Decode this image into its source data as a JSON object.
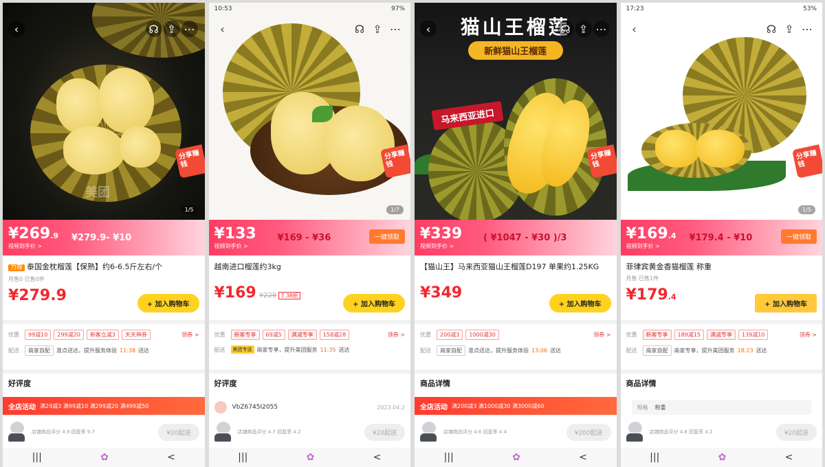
{
  "screens": [
    {
      "status": {
        "time": "",
        "right": ""
      },
      "watermark": "美团",
      "share": "分享赚钱",
      "pager": "1/5",
      "price_main": "¥269",
      "price_cents": ".9",
      "price_label": "视频到手价 >",
      "range": "¥279.9- ¥10",
      "range_label": "",
      "title_tag": "力荐",
      "title": "泰国金枕榴莲【保熟】约6-6.5斤左右/个",
      "subtitle": "月售0 已售0件",
      "big_price": "¥279.9",
      "old_price": "",
      "discount": "",
      "cart": "+ 加入购物车",
      "chips_label": "优惠",
      "chips": [
        "99减10",
        "299减20",
        "新客立减3",
        "天天神券"
      ],
      "more": "领券 >",
      "delivery_label": "配送",
      "delivery_tag": "商家自配",
      "delivery_text": "准点送达，提升服务体验",
      "delivery_time": "11:38",
      "delivery_end": "送达",
      "review": "好评度",
      "activity_title": "全店活动",
      "activity_text": "满29减3 满99减10 满299减20 满499减50",
      "bottom_text": "店铺商品评分 4.9   回复率 9.7",
      "follow": "¥20起送"
    },
    {
      "status": {
        "time": "10:53",
        "right": "97%"
      },
      "share": "分享赚钱",
      "pager": "1/7",
      "price_main": "¥133",
      "price_label": "视频到手价 >",
      "range": "¥169 - ¥36",
      "range_label": "",
      "grab": "一键领取",
      "title": "越南进口榴莲约3kg",
      "big_price": "¥169",
      "old_price": "¥229",
      "discount": "7.38折",
      "cart": "+ 加入购物车",
      "chips_label": "优惠",
      "chips": [
        "新客专享",
        "69减5",
        "满减专享",
        "158减28"
      ],
      "more": "领券 >",
      "delivery_label": "配送",
      "delivery_tag": "美团专送",
      "delivery_text": "商家专享，提升美团服务",
      "delivery_time": "11:35",
      "delivery_end": "送达",
      "review": "好评度",
      "user": "VbZ6745I2055",
      "user_date": "2023.04.2",
      "bottom_text": "店铺商品评分 4.7   回复率 4.2",
      "follow": "¥20起送"
    },
    {
      "status": {
        "time": "",
        "right": ""
      },
      "hero_title": "猫山王榴莲",
      "hero_sub": "新鲜猫山王榴莲",
      "import_tag": "马来西亚进口",
      "share": "分享赚钱",
      "price_main": "¥339",
      "price_label": "视频到手价 >",
      "range": "( ¥1047 - ¥30 )/3",
      "range_label": "",
      "title": "【猫山王】马来西亚猫山王榴莲D197 单果约1.25KG",
      "big_price": "¥349",
      "cart": "+ 加入购物车",
      "chips_label": "优惠",
      "chips": [
        "200减3",
        "1000减30"
      ],
      "more": "领券 >",
      "delivery_label": "配送",
      "delivery_tag": "商家自配",
      "delivery_text": "准点送达，提升服务体验",
      "delivery_time": "13:06",
      "delivery_end": "送达",
      "review": "商品详情",
      "activity_title": "全店活动",
      "activity_text": "满200减3 满1000减30 满3000减60",
      "bottom_text": "店铺商品评分 4.6   回复率 4.4",
      "follow": "¥200起送"
    },
    {
      "status": {
        "time": "17:23",
        "right": "53%"
      },
      "share": "分享赚钱",
      "pager": "1/5",
      "price_main": "¥169",
      "price_cents": ".4",
      "price_label": "视频到手价 >",
      "range": "¥179.4 - ¥10",
      "range_label": "",
      "grab": "一键领取",
      "title": "菲律宾黄金香猫榴莲 称重",
      "subtitle": "月售 已售1件",
      "big_price": "¥179",
      "big_price_cents": ".4",
      "cart": "+ 加入购物车",
      "chips_label": "优惠",
      "chips": [
        "新客专享",
        "189减15",
        "满减专享",
        "139减10"
      ],
      "more": "领券 >",
      "delivery_label": "配送",
      "delivery_tag": "商家自配",
      "delivery_text": "商家专享，提升美团服务",
      "delivery_time": "18:23",
      "delivery_end": "送达",
      "review": "商品详情",
      "spec_label": "规格",
      "spec_value": "称重",
      "bottom_text": "店铺商品评分 4.6   回复率 4.2",
      "follow": "¥20起送"
    }
  ],
  "nav": {
    "recent": "|||",
    "home": "✿",
    "back": "<"
  }
}
